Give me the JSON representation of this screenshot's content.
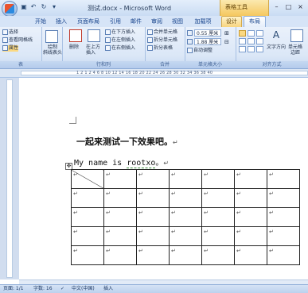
{
  "window": {
    "title": "测试.docx - Microsoft Word",
    "contextual_group": "表格工具",
    "controls": [
      "–",
      "□",
      "×"
    ]
  },
  "quick_access": {
    "icons": [
      "save-icon",
      "undo-icon",
      "redo-icon",
      "customize-icon"
    ]
  },
  "tabs": [
    "开始",
    "插入",
    "页面布局",
    "引用",
    "邮件",
    "审阅",
    "视图",
    "加载项",
    "设计",
    "布局"
  ],
  "active_tab": "布局",
  "ribbon": {
    "table_group": {
      "label": "表",
      "select": "选择",
      "gridlines": "查看网格线",
      "properties": "属性"
    },
    "draw_group": {
      "draw_diagonal": "绘制\n斜线表头"
    },
    "rows_cols_group": {
      "label": "行和列",
      "delete": "删除",
      "insert_above": "在上方\n插入",
      "insert_below": "在下方插入",
      "insert_left": "在左侧插入",
      "insert_right": "在右侧插入"
    },
    "merge_group": {
      "label": "合并",
      "merge_cells": "合并单元格",
      "split_cells": "拆分单元格",
      "split_table": "拆分表格"
    },
    "cell_size_group": {
      "label": "单元格大小",
      "height": "0.55 厘米",
      "width": "1.88 厘米",
      "autofit": "自动调整"
    },
    "alignment_group": {
      "label": "对齐方式",
      "text_direction": "文字方向",
      "cell_margins": "单元格\n边距"
    }
  },
  "ruler": {
    "ticks": "1 2 1  2  4  6  8  10  12  14  16  18  20  22  24  26  28  30  32  34  36  38  40"
  },
  "document": {
    "heading": "一起来测试一下效果吧。",
    "name_prefix": "My name is ",
    "name_value": "rootxo",
    "name_suffix": "。",
    "paragraph_mark": "↵",
    "table": {
      "rows": 5,
      "cols": 7,
      "cell_mark": "↵"
    }
  },
  "status": {
    "page": "页面: 1/1",
    "words": "字数: 16",
    "language": "中文(中国)",
    "mode": "插入"
  }
}
